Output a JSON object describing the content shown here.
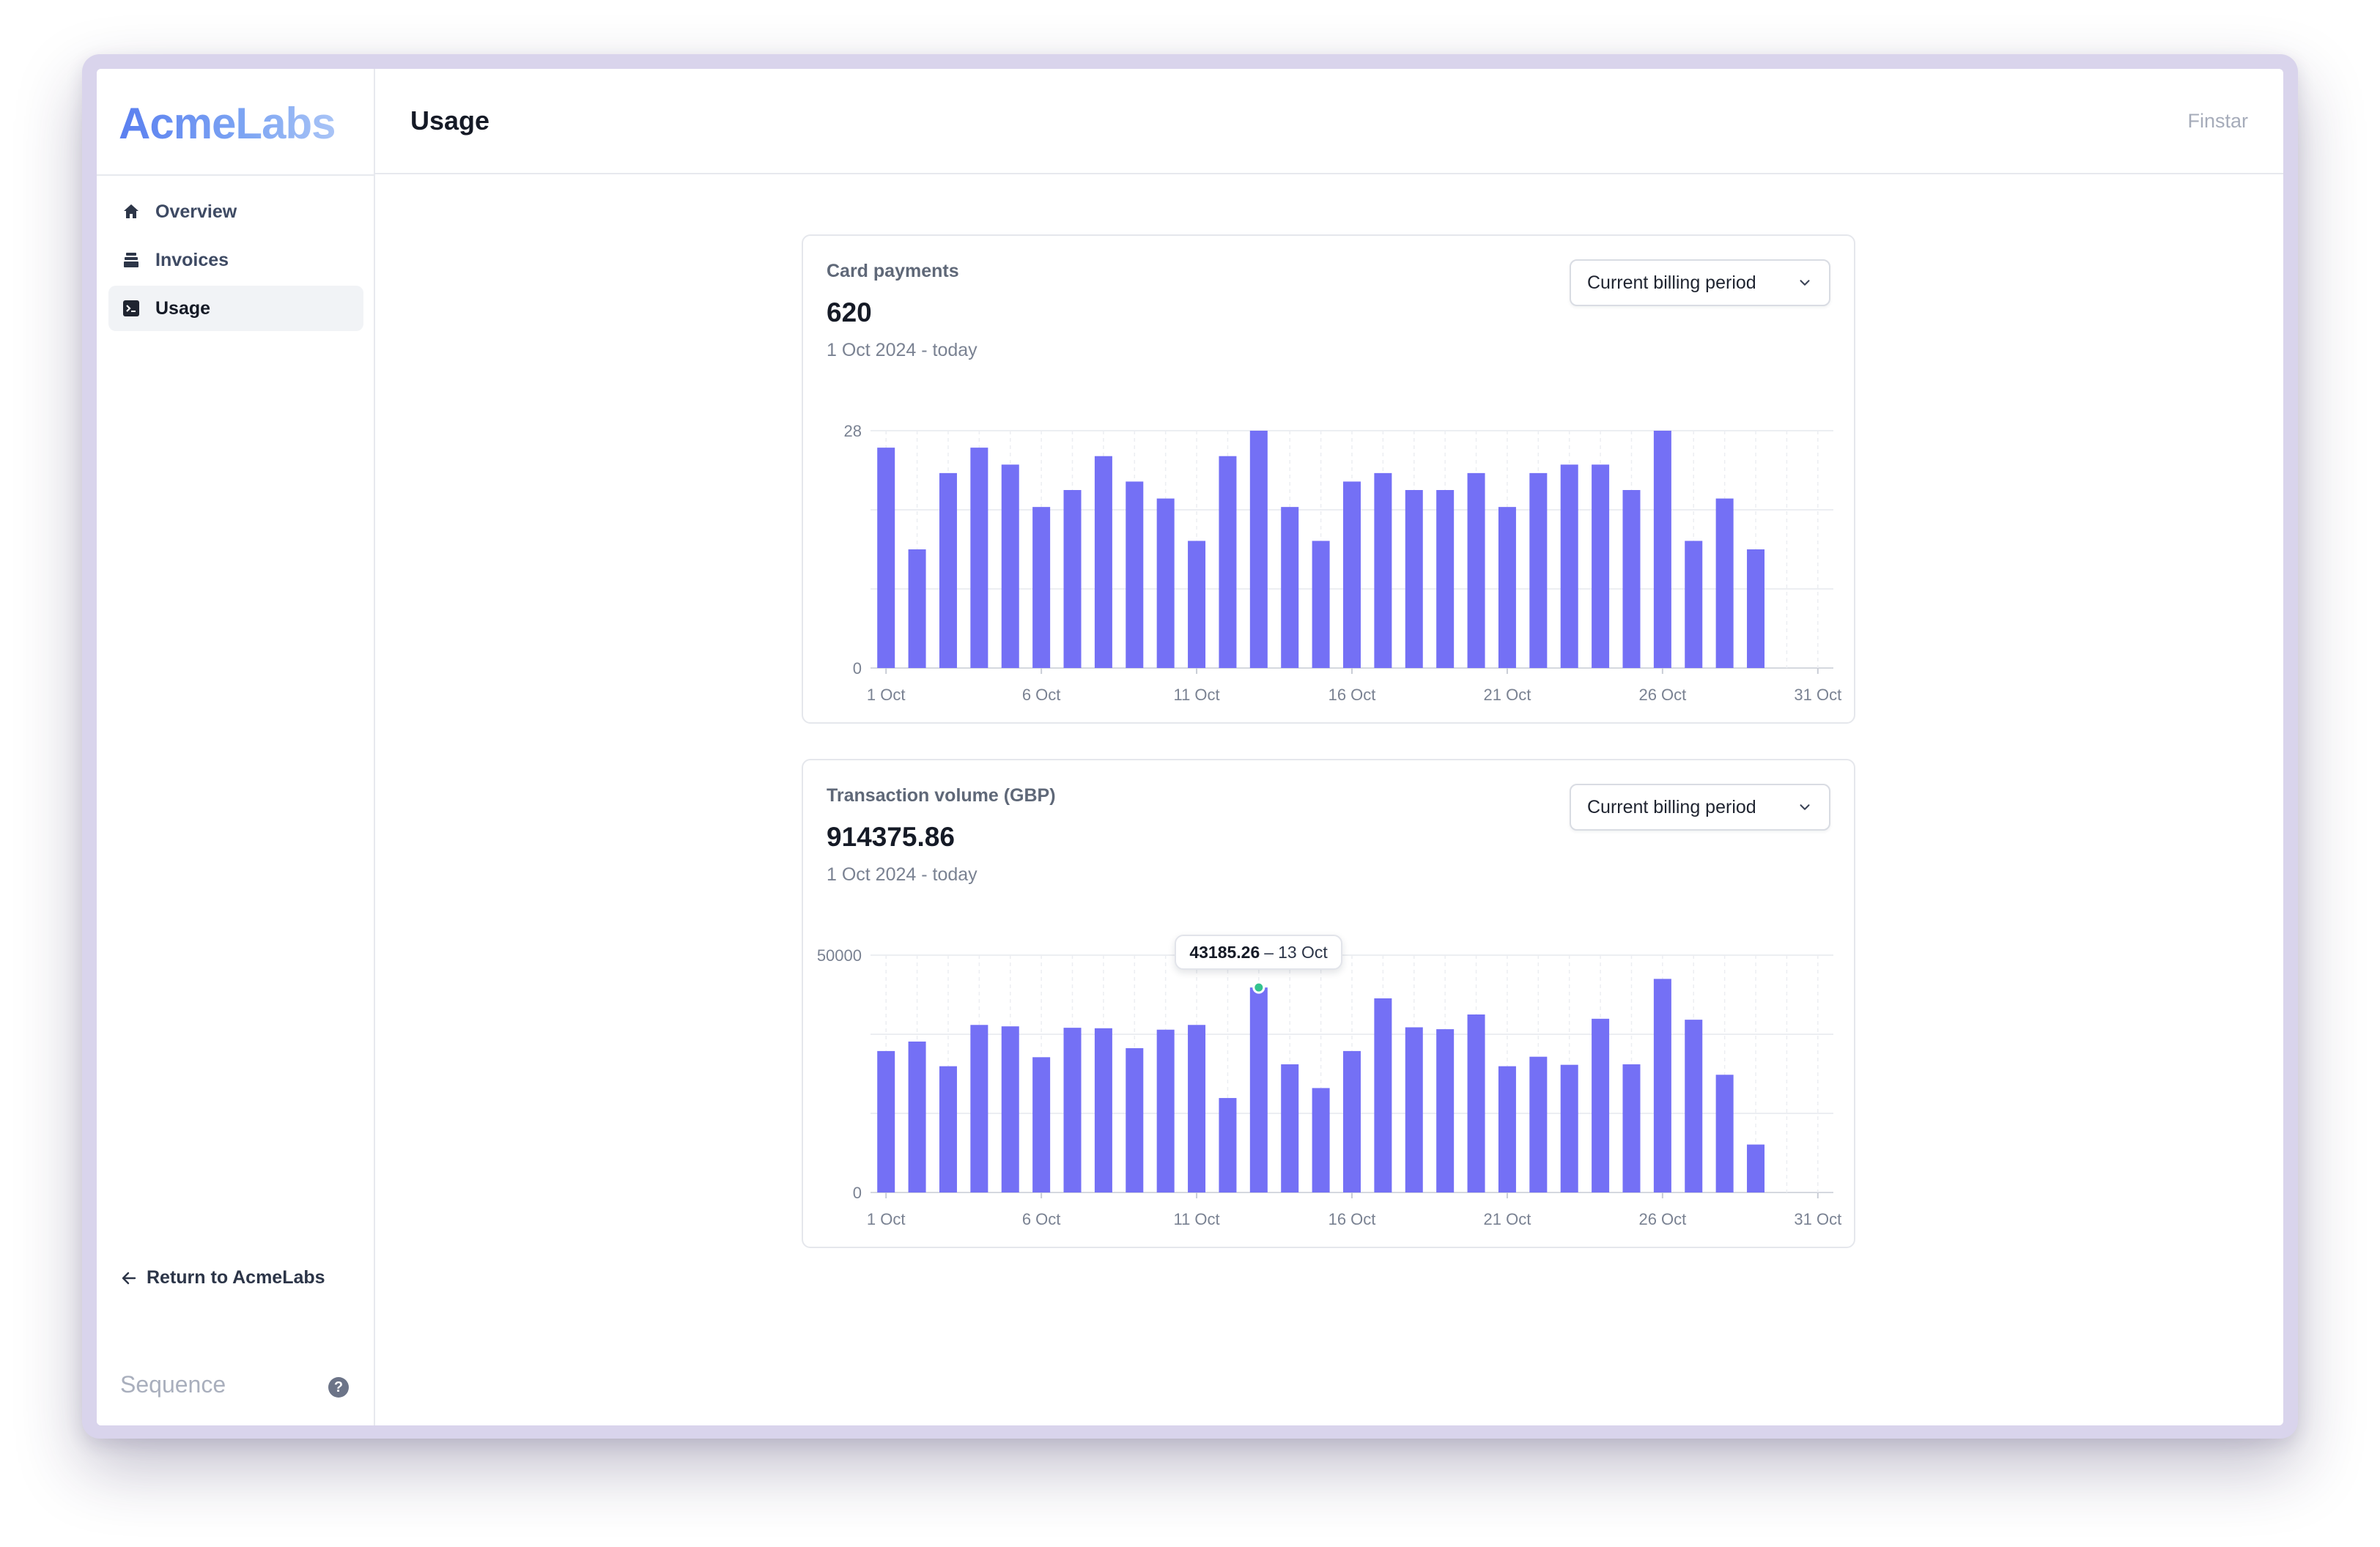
{
  "brand": {
    "logo_text": "AcmeLabs",
    "footer_brand": "Sequence"
  },
  "sidebar": {
    "items": [
      {
        "label": "Overview",
        "icon": "home-icon",
        "active": false
      },
      {
        "label": "Invoices",
        "icon": "invoices-icon",
        "active": false
      },
      {
        "label": "Usage",
        "icon": "terminal-icon",
        "active": true
      }
    ],
    "return_label": "Return to AcmeLabs"
  },
  "header": {
    "title": "Usage",
    "org_name": "Finstar"
  },
  "colors": {
    "bar": "#7470f5",
    "accent": "#5a7ff0",
    "highlight_dot": "#34c38f"
  },
  "cards": [
    {
      "label": "Card payments",
      "value": "620",
      "range": "1 Oct 2024 - today",
      "period_select": "Current billing period",
      "y_ticks": [
        "28",
        "0"
      ],
      "x_ticks": [
        "1 Oct",
        "6 Oct",
        "11 Oct",
        "16 Oct",
        "21 Oct",
        "26 Oct",
        "31 Oct"
      ]
    },
    {
      "label": "Transaction volume (GBP)",
      "value": "914375.86",
      "range": "1 Oct 2024 - today",
      "period_select": "Current billing period",
      "y_ticks": [
        "50000",
        "0"
      ],
      "x_ticks": [
        "1 Oct",
        "6 Oct",
        "11 Oct",
        "16 Oct",
        "21 Oct",
        "26 Oct",
        "31 Oct"
      ],
      "tooltip": {
        "value": "43185.26",
        "separator": "–",
        "date": "13 Oct"
      }
    }
  ],
  "chart_data": [
    {
      "type": "bar",
      "title": "Card payments",
      "categories": [
        "1 Oct",
        "2 Oct",
        "3 Oct",
        "4 Oct",
        "5 Oct",
        "6 Oct",
        "7 Oct",
        "8 Oct",
        "9 Oct",
        "10 Oct",
        "11 Oct",
        "12 Oct",
        "13 Oct",
        "14 Oct",
        "15 Oct",
        "16 Oct",
        "17 Oct",
        "18 Oct",
        "19 Oct",
        "20 Oct",
        "21 Oct",
        "22 Oct",
        "23 Oct",
        "24 Oct",
        "25 Oct",
        "26 Oct",
        "27 Oct",
        "28 Oct",
        "29 Oct",
        "30 Oct",
        "31 Oct"
      ],
      "values": [
        26,
        14,
        23,
        26,
        24,
        19,
        21,
        25,
        22,
        20,
        15,
        25,
        28,
        19,
        15,
        22,
        23,
        21,
        21,
        23,
        19,
        23,
        24,
        24,
        21,
        28,
        15,
        20,
        14,
        null,
        null
      ],
      "ylim": [
        0,
        28
      ],
      "grid": true
    },
    {
      "type": "bar",
      "title": "Transaction volume (GBP)",
      "categories": [
        "1 Oct",
        "2 Oct",
        "3 Oct",
        "4 Oct",
        "5 Oct",
        "6 Oct",
        "7 Oct",
        "8 Oct",
        "9 Oct",
        "10 Oct",
        "11 Oct",
        "12 Oct",
        "13 Oct",
        "14 Oct",
        "15 Oct",
        "16 Oct",
        "17 Oct",
        "18 Oct",
        "19 Oct",
        "20 Oct",
        "21 Oct",
        "22 Oct",
        "23 Oct",
        "24 Oct",
        "25 Oct",
        "26 Oct",
        "27 Oct",
        "28 Oct",
        "29 Oct",
        "30 Oct",
        "31 Oct"
      ],
      "values": [
        29800,
        31800,
        26600,
        35300,
        35000,
        28500,
        34700,
        34600,
        30400,
        34300,
        35300,
        19900,
        43185.26,
        27000,
        22000,
        29800,
        40900,
        34800,
        34400,
        37500,
        26600,
        28600,
        26900,
        36600,
        27000,
        45000,
        36400,
        24800,
        10100,
        null,
        null
      ],
      "ylim": [
        0,
        50000
      ],
      "grid": true,
      "highlighted_index": 12
    }
  ]
}
